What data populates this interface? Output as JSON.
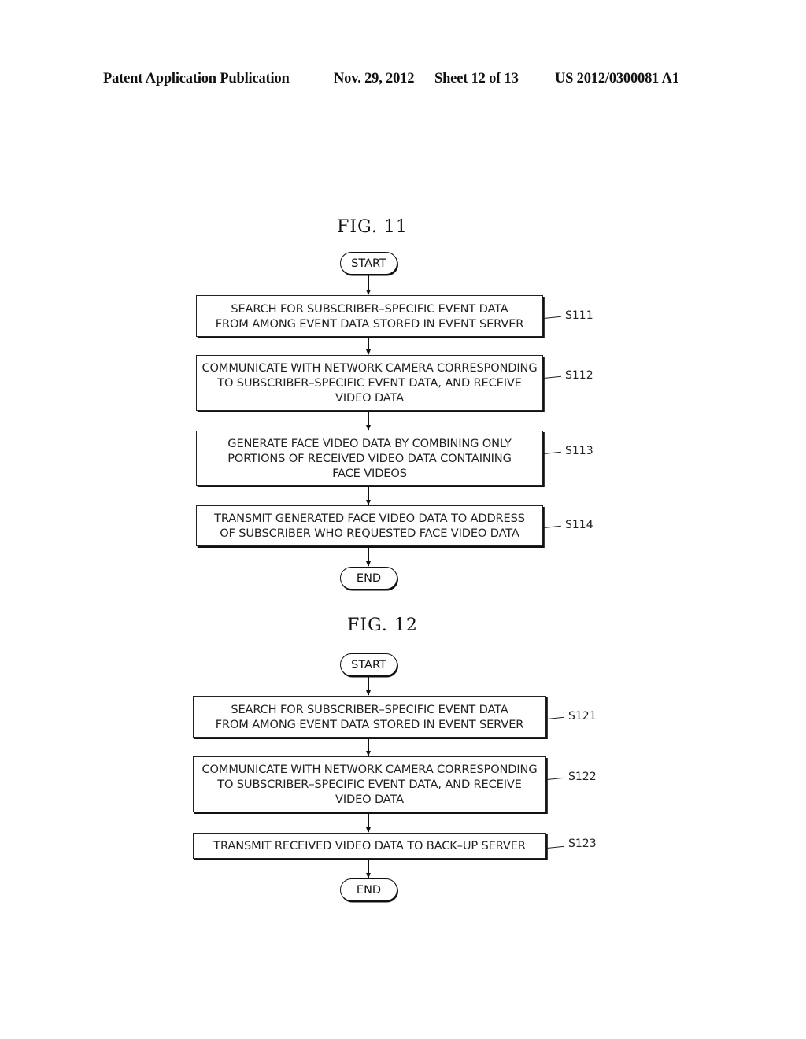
{
  "header": {
    "publication_type": "Patent Application Publication",
    "date": "Nov. 29, 2012",
    "sheet": "Sheet 12 of 13",
    "patent_number": "US 2012/0300081 A1"
  },
  "figures": [
    {
      "title": "FIG.  11",
      "start_label": "START",
      "end_label": "END",
      "steps": [
        {
          "id": "S111",
          "text": "SEARCH FOR SUBSCRIBER–SPECIFIC EVENT DATA\nFROM AMONG EVENT DATA STORED IN EVENT SERVER"
        },
        {
          "id": "S112",
          "text": "COMMUNICATE WITH NETWORK CAMERA CORRESPONDING\nTO SUBSCRIBER–SPECIFIC EVENT DATA, AND RECEIVE\nVIDEO DATA"
        },
        {
          "id": "S113",
          "text": "GENERATE FACE VIDEO DATA BY COMBINING ONLY\nPORTIONS OF RECEIVED VIDEO DATA CONTAINING\nFACE VIDEOS"
        },
        {
          "id": "S114",
          "text": "TRANSMIT GENERATED FACE VIDEO DATA TO ADDRESS\nOF SUBSCRIBER WHO REQUESTED FACE VIDEO DATA"
        }
      ]
    },
    {
      "title": "FIG.  12",
      "start_label": "START",
      "end_label": "END",
      "steps": [
        {
          "id": "S121",
          "text": "SEARCH FOR SUBSCRIBER–SPECIFIC EVENT DATA\nFROM AMONG EVENT DATA STORED IN EVENT SERVER"
        },
        {
          "id": "S122",
          "text": "COMMUNICATE WITH NETWORK CAMERA CORRESPONDING\nTO SUBSCRIBER–SPECIFIC EVENT DATA, AND RECEIVE\nVIDEO DATA"
        },
        {
          "id": "S123",
          "text": "TRANSMIT RECEIVED VIDEO DATA TO BACK–UP SERVER"
        }
      ]
    }
  ]
}
